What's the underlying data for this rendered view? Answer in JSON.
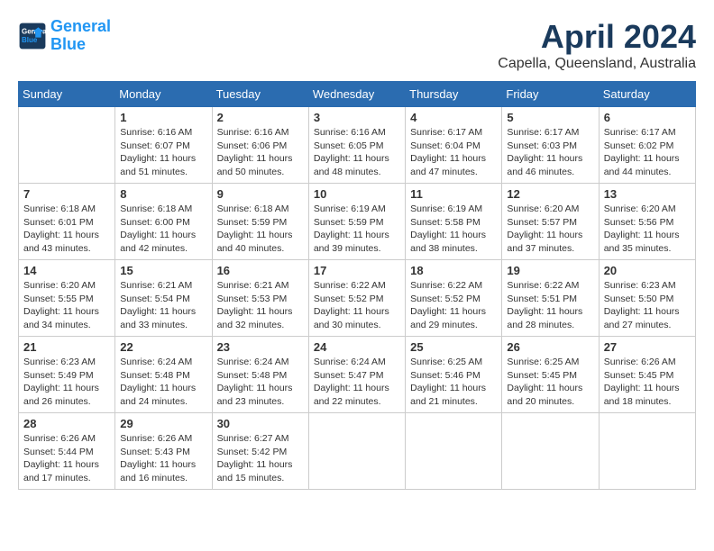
{
  "header": {
    "logo_line1": "General",
    "logo_line2": "Blue",
    "month": "April 2024",
    "location": "Capella, Queensland, Australia"
  },
  "weekdays": [
    "Sunday",
    "Monday",
    "Tuesday",
    "Wednesday",
    "Thursday",
    "Friday",
    "Saturday"
  ],
  "weeks": [
    [
      {
        "day": "",
        "info": ""
      },
      {
        "day": "1",
        "info": "Sunrise: 6:16 AM\nSunset: 6:07 PM\nDaylight: 11 hours\nand 51 minutes."
      },
      {
        "day": "2",
        "info": "Sunrise: 6:16 AM\nSunset: 6:06 PM\nDaylight: 11 hours\nand 50 minutes."
      },
      {
        "day": "3",
        "info": "Sunrise: 6:16 AM\nSunset: 6:05 PM\nDaylight: 11 hours\nand 48 minutes."
      },
      {
        "day": "4",
        "info": "Sunrise: 6:17 AM\nSunset: 6:04 PM\nDaylight: 11 hours\nand 47 minutes."
      },
      {
        "day": "5",
        "info": "Sunrise: 6:17 AM\nSunset: 6:03 PM\nDaylight: 11 hours\nand 46 minutes."
      },
      {
        "day": "6",
        "info": "Sunrise: 6:17 AM\nSunset: 6:02 PM\nDaylight: 11 hours\nand 44 minutes."
      }
    ],
    [
      {
        "day": "7",
        "info": "Sunrise: 6:18 AM\nSunset: 6:01 PM\nDaylight: 11 hours\nand 43 minutes."
      },
      {
        "day": "8",
        "info": "Sunrise: 6:18 AM\nSunset: 6:00 PM\nDaylight: 11 hours\nand 42 minutes."
      },
      {
        "day": "9",
        "info": "Sunrise: 6:18 AM\nSunset: 5:59 PM\nDaylight: 11 hours\nand 40 minutes."
      },
      {
        "day": "10",
        "info": "Sunrise: 6:19 AM\nSunset: 5:59 PM\nDaylight: 11 hours\nand 39 minutes."
      },
      {
        "day": "11",
        "info": "Sunrise: 6:19 AM\nSunset: 5:58 PM\nDaylight: 11 hours\nand 38 minutes."
      },
      {
        "day": "12",
        "info": "Sunrise: 6:20 AM\nSunset: 5:57 PM\nDaylight: 11 hours\nand 37 minutes."
      },
      {
        "day": "13",
        "info": "Sunrise: 6:20 AM\nSunset: 5:56 PM\nDaylight: 11 hours\nand 35 minutes."
      }
    ],
    [
      {
        "day": "14",
        "info": "Sunrise: 6:20 AM\nSunset: 5:55 PM\nDaylight: 11 hours\nand 34 minutes."
      },
      {
        "day": "15",
        "info": "Sunrise: 6:21 AM\nSunset: 5:54 PM\nDaylight: 11 hours\nand 33 minutes."
      },
      {
        "day": "16",
        "info": "Sunrise: 6:21 AM\nSunset: 5:53 PM\nDaylight: 11 hours\nand 32 minutes."
      },
      {
        "day": "17",
        "info": "Sunrise: 6:22 AM\nSunset: 5:52 PM\nDaylight: 11 hours\nand 30 minutes."
      },
      {
        "day": "18",
        "info": "Sunrise: 6:22 AM\nSunset: 5:52 PM\nDaylight: 11 hours\nand 29 minutes."
      },
      {
        "day": "19",
        "info": "Sunrise: 6:22 AM\nSunset: 5:51 PM\nDaylight: 11 hours\nand 28 minutes."
      },
      {
        "day": "20",
        "info": "Sunrise: 6:23 AM\nSunset: 5:50 PM\nDaylight: 11 hours\nand 27 minutes."
      }
    ],
    [
      {
        "day": "21",
        "info": "Sunrise: 6:23 AM\nSunset: 5:49 PM\nDaylight: 11 hours\nand 26 minutes."
      },
      {
        "day": "22",
        "info": "Sunrise: 6:24 AM\nSunset: 5:48 PM\nDaylight: 11 hours\nand 24 minutes."
      },
      {
        "day": "23",
        "info": "Sunrise: 6:24 AM\nSunset: 5:48 PM\nDaylight: 11 hours\nand 23 minutes."
      },
      {
        "day": "24",
        "info": "Sunrise: 6:24 AM\nSunset: 5:47 PM\nDaylight: 11 hours\nand 22 minutes."
      },
      {
        "day": "25",
        "info": "Sunrise: 6:25 AM\nSunset: 5:46 PM\nDaylight: 11 hours\nand 21 minutes."
      },
      {
        "day": "26",
        "info": "Sunrise: 6:25 AM\nSunset: 5:45 PM\nDaylight: 11 hours\nand 20 minutes."
      },
      {
        "day": "27",
        "info": "Sunrise: 6:26 AM\nSunset: 5:45 PM\nDaylight: 11 hours\nand 18 minutes."
      }
    ],
    [
      {
        "day": "28",
        "info": "Sunrise: 6:26 AM\nSunset: 5:44 PM\nDaylight: 11 hours\nand 17 minutes."
      },
      {
        "day": "29",
        "info": "Sunrise: 6:26 AM\nSunset: 5:43 PM\nDaylight: 11 hours\nand 16 minutes."
      },
      {
        "day": "30",
        "info": "Sunrise: 6:27 AM\nSunset: 5:42 PM\nDaylight: 11 hours\nand 15 minutes."
      },
      {
        "day": "",
        "info": ""
      },
      {
        "day": "",
        "info": ""
      },
      {
        "day": "",
        "info": ""
      },
      {
        "day": "",
        "info": ""
      }
    ]
  ]
}
